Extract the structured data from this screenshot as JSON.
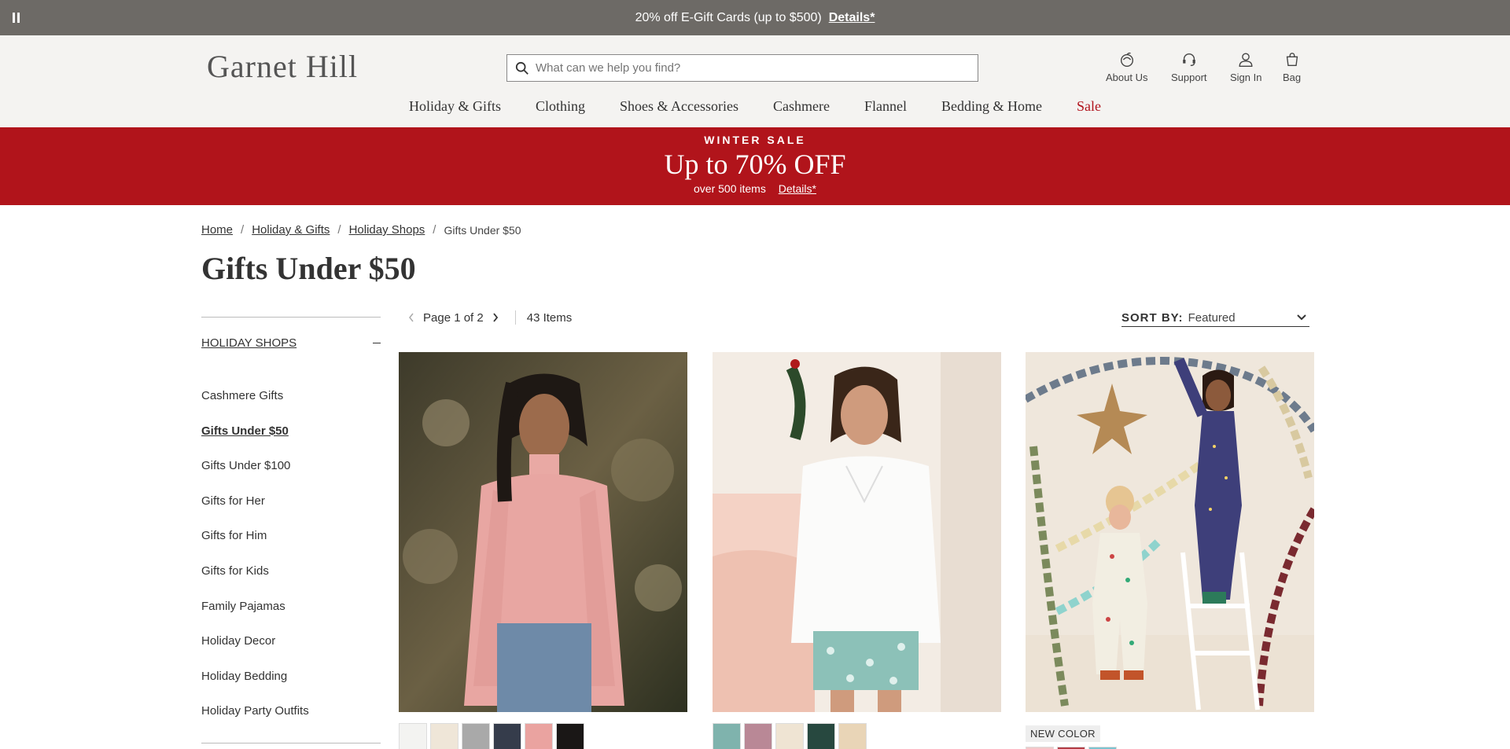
{
  "promo": {
    "text": "20% off E-Gift Cards (up to $500)",
    "details": "Details*"
  },
  "header": {
    "logo": "Garnet Hill",
    "search_placeholder": "What can we help you find?",
    "utilities": [
      {
        "label": "About Us",
        "icon": "garnet-icon"
      },
      {
        "label": "Support",
        "icon": "headset-icon"
      },
      {
        "label": "Sign In",
        "icon": "person-icon"
      },
      {
        "label": "Bag",
        "icon": "bag-icon"
      }
    ],
    "nav": [
      "Holiday & Gifts",
      "Clothing",
      "Shoes & Accessories",
      "Cashmere",
      "Flannel",
      "Bedding & Home",
      "Sale"
    ]
  },
  "sale_banner": {
    "kicker": "WINTER SALE",
    "headline": "Up to 70% OFF",
    "sub": "over 500 items",
    "details": "Details*"
  },
  "breadcrumb": {
    "home": "Home",
    "holiday": "Holiday & Gifts",
    "shops": "Holiday Shops",
    "current": "Gifts Under $50"
  },
  "page_title": "Gifts Under $50",
  "sidebar": {
    "heading": "HOLIDAY SHOPS",
    "items": [
      "Cashmere Gifts",
      "Gifts Under $50",
      "Gifts Under $100",
      "Gifts for Her",
      "Gifts for Him",
      "Gifts for Kids",
      "Family Pajamas",
      "Holiday Decor",
      "Holiday Bedding",
      "Holiday Party Outfits"
    ],
    "active_index": 1
  },
  "toolbar": {
    "page": "Page 1 of 2",
    "items": "43 Items",
    "sort_label": "SORT BY:",
    "sort_value": "Featured"
  },
  "products": [
    {
      "swatches": [
        "#f3f3f1",
        "#efe6d8",
        "#a9a9a9",
        "#353c4b",
        "#eaa3a0",
        "#1a1716"
      ]
    },
    {
      "swatches": [
        "#7fb3ad",
        "#b98896",
        "#efe4d3",
        "#27483f",
        "#e9d5b7"
      ]
    },
    {
      "badge": "NEW COLOR",
      "swatches": [
        "#f1c9c9",
        "#b33d45",
        "#7cc4d0"
      ]
    }
  ],
  "colors": {
    "promo_bg": "#6d6a66",
    "header_bg": "#f4f3f1",
    "sale_red": "#b1141b",
    "accent_red": "#b1131c"
  }
}
